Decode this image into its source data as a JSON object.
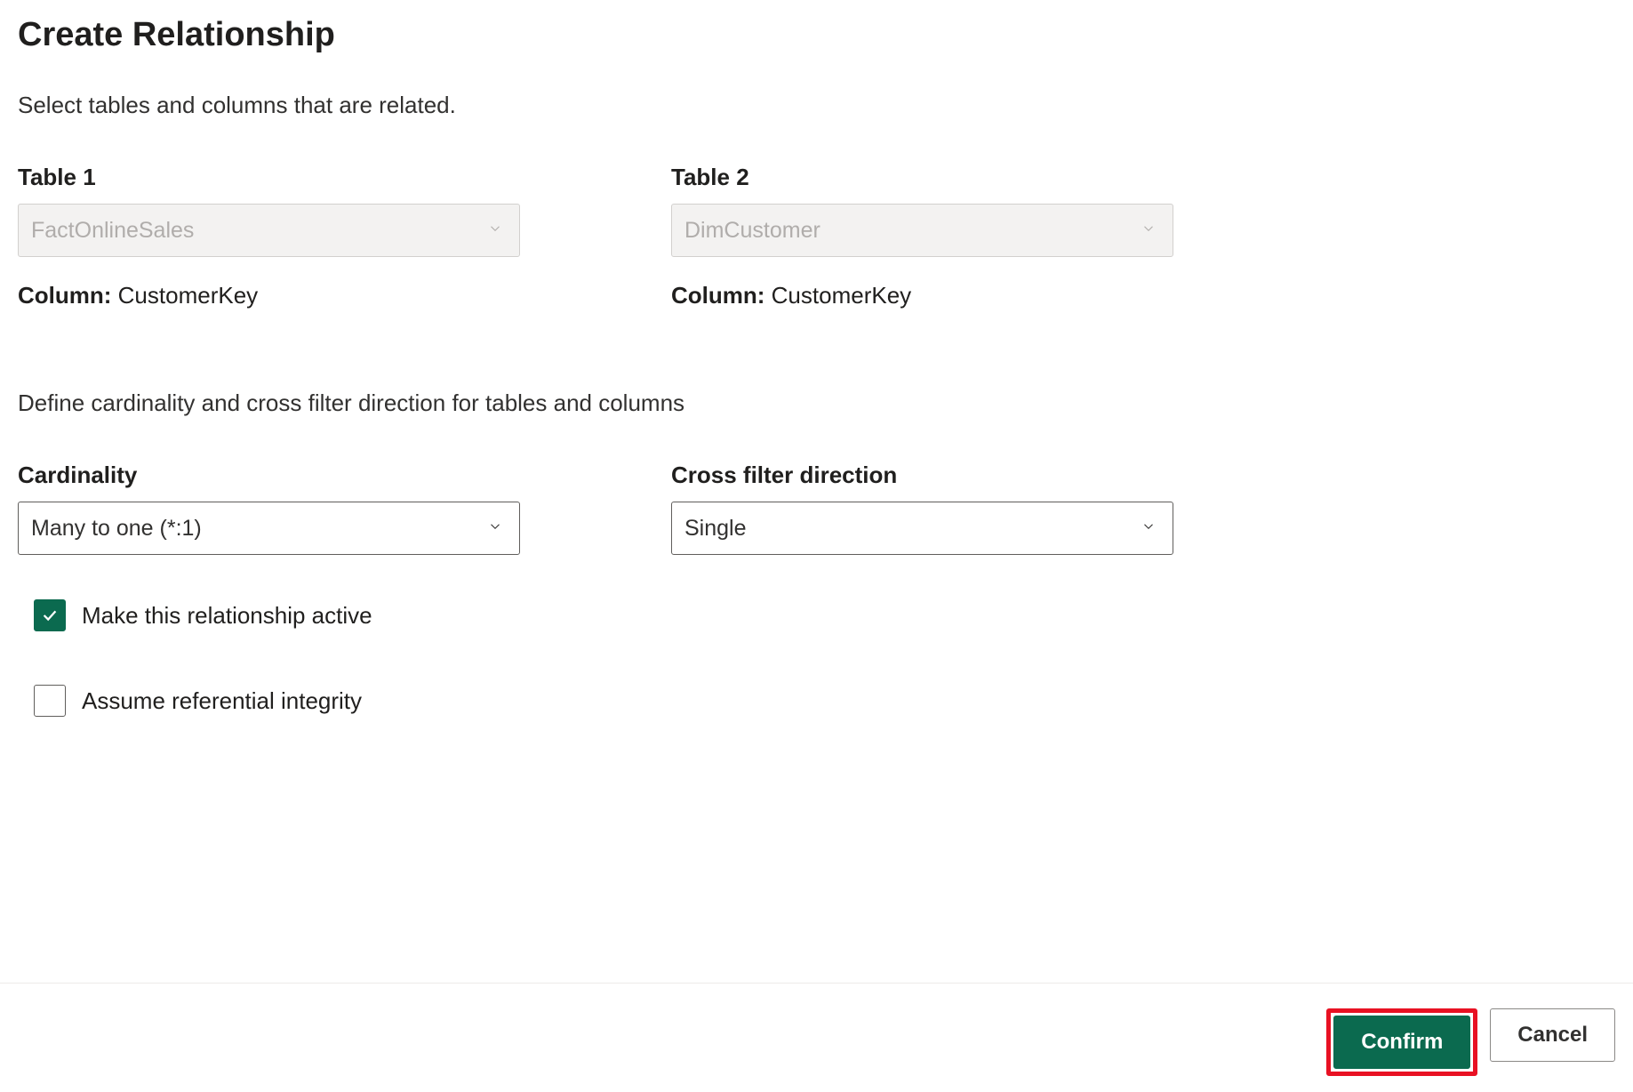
{
  "dialog": {
    "title": "Create Relationship",
    "subtitle": "Select tables and columns that are related."
  },
  "table1": {
    "heading": "Table 1",
    "value": "FactOnlineSales",
    "column_label": "Column:",
    "column_value": "CustomerKey"
  },
  "table2": {
    "heading": "Table 2",
    "value": "DimCustomer",
    "column_label": "Column:",
    "column_value": "CustomerKey"
  },
  "cardinality_section": {
    "subtitle": "Define cardinality and cross filter direction for tables and columns"
  },
  "cardinality": {
    "heading": "Cardinality",
    "value": "Many to one (*:1)"
  },
  "cross_filter": {
    "heading": "Cross filter direction",
    "value": "Single"
  },
  "checkboxes": {
    "active_label": "Make this relationship active",
    "active_checked": true,
    "integrity_label": "Assume referential integrity",
    "integrity_checked": false
  },
  "buttons": {
    "confirm": "Confirm",
    "cancel": "Cancel"
  }
}
